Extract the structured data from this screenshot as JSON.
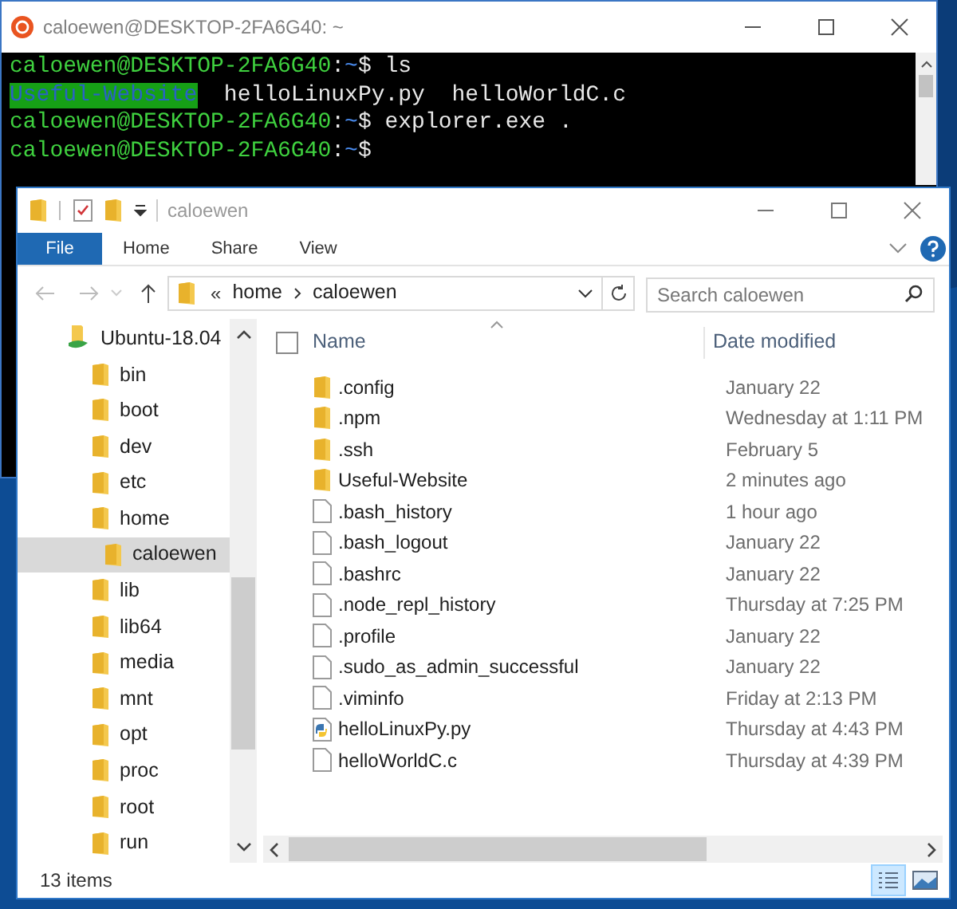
{
  "terminal": {
    "title": "caloewen@DESKTOP-2FA6G40: ~",
    "lines": [
      {
        "segments": [
          {
            "kind": "user",
            "text": "caloewen@DESKTOP-2FA6G40"
          },
          {
            "kind": "plain",
            "text": ":"
          },
          {
            "kind": "path",
            "text": "~"
          },
          {
            "kind": "plain",
            "text": "$ ls"
          }
        ]
      },
      {
        "segments": [
          {
            "kind": "dir",
            "text": "Useful-Website"
          },
          {
            "kind": "plain",
            "text": "  helloLinuxPy.py  helloWorldC.c"
          }
        ]
      },
      {
        "segments": [
          {
            "kind": "user",
            "text": "caloewen@DESKTOP-2FA6G40"
          },
          {
            "kind": "plain",
            "text": ":"
          },
          {
            "kind": "path",
            "text": "~"
          },
          {
            "kind": "plain",
            "text": "$ explorer.exe ."
          }
        ]
      },
      {
        "segments": [
          {
            "kind": "user",
            "text": "caloewen@DESKTOP-2FA6G40"
          },
          {
            "kind": "plain",
            "text": ":"
          },
          {
            "kind": "path",
            "text": "~"
          },
          {
            "kind": "plain",
            "text": "$"
          }
        ]
      }
    ]
  },
  "explorer": {
    "title": "caloewen",
    "ribbon_tabs": [
      {
        "label": "File",
        "selected": true
      },
      {
        "label": "Home",
        "selected": false
      },
      {
        "label": "Share",
        "selected": false
      },
      {
        "label": "View",
        "selected": false
      }
    ],
    "address": {
      "overflow": "«",
      "crumbs": [
        "home",
        "caloewen"
      ]
    },
    "search": {
      "placeholder": "Search caloewen"
    },
    "tree": [
      {
        "label": "Ubuntu-18.04",
        "kind": "drive",
        "selected": false,
        "children": [
          {
            "label": "bin",
            "selected": false
          },
          {
            "label": "boot",
            "selected": false
          },
          {
            "label": "dev",
            "selected": false
          },
          {
            "label": "etc",
            "selected": false
          },
          {
            "label": "home",
            "selected": false,
            "children": [
              {
                "label": "caloewen",
                "selected": true
              }
            ]
          },
          {
            "label": "lib",
            "selected": false
          },
          {
            "label": "lib64",
            "selected": false
          },
          {
            "label": "media",
            "selected": false
          },
          {
            "label": "mnt",
            "selected": false
          },
          {
            "label": "opt",
            "selected": false
          },
          {
            "label": "proc",
            "selected": false
          },
          {
            "label": "root",
            "selected": false
          },
          {
            "label": "run",
            "selected": false
          }
        ]
      }
    ],
    "select_all": {
      "checked": false
    },
    "columns": [
      "Name",
      "Date modified"
    ],
    "files": [
      {
        "name": ".config",
        "date": "January 22",
        "kind": "folder"
      },
      {
        "name": ".npm",
        "date": "Wednesday at 1:11 PM",
        "kind": "folder"
      },
      {
        "name": ".ssh",
        "date": "February 5",
        "kind": "folder"
      },
      {
        "name": "Useful-Website",
        "date": "2 minutes ago",
        "kind": "folder"
      },
      {
        "name": ".bash_history",
        "date": "1 hour ago",
        "kind": "file"
      },
      {
        "name": ".bash_logout",
        "date": "January 22",
        "kind": "file"
      },
      {
        "name": ".bashrc",
        "date": "January 22",
        "kind": "file"
      },
      {
        "name": ".node_repl_history",
        "date": "Thursday at 7:25 PM",
        "kind": "file"
      },
      {
        "name": ".profile",
        "date": "January 22",
        "kind": "file"
      },
      {
        "name": ".sudo_as_admin_successful",
        "date": "January 22",
        "kind": "file"
      },
      {
        "name": ".viminfo",
        "date": "Friday at 2:13 PM",
        "kind": "file"
      },
      {
        "name": "helloLinuxPy.py",
        "date": "Thursday at 4:43 PM",
        "kind": "python"
      },
      {
        "name": "helloWorldC.c",
        "date": "Thursday at 4:39 PM",
        "kind": "file"
      }
    ],
    "status": "13 items",
    "views": [
      {
        "kind": "details",
        "selected": true
      },
      {
        "kind": "tiles",
        "selected": false
      }
    ]
  }
}
